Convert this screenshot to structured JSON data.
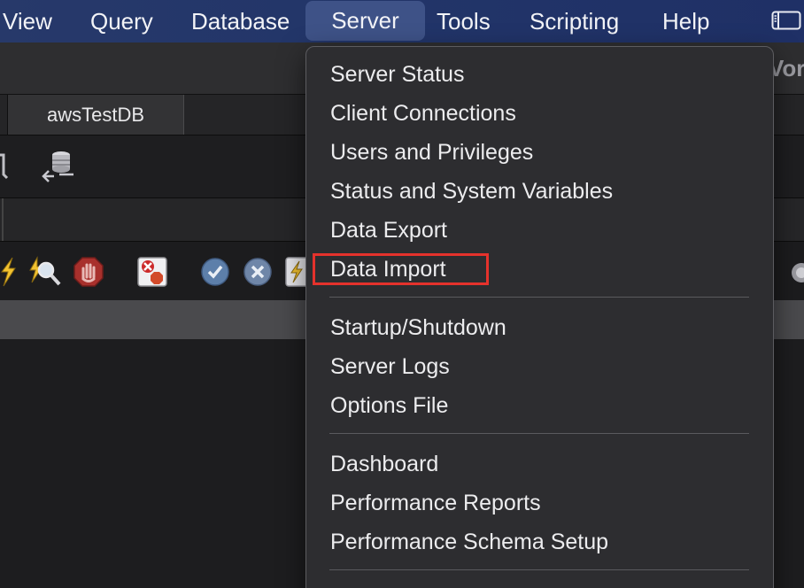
{
  "menubar": {
    "items": [
      "View",
      "Query",
      "Database",
      "Server",
      "Tools",
      "Scripting",
      "Help"
    ],
    "active": "Server",
    "status_icon": "window-sidebar-icon"
  },
  "window": {
    "title_fragment": "Vork",
    "tab_label": "awsTestDB"
  },
  "server_menu": {
    "groups": [
      [
        "Server Status",
        "Client Connections",
        "Users and Privileges",
        "Status and System Variables",
        "Data Export",
        "Data Import"
      ],
      [
        "Startup/Shutdown",
        "Server Logs",
        "Options File"
      ],
      [
        "Dashboard",
        "Performance Reports",
        "Performance Schema Setup"
      ]
    ],
    "highlighted_item": "Data Import",
    "highlight_color": "#e5322c"
  },
  "toolbar_icons": [
    "database-connect-icon",
    "execute-lightning-icon",
    "inspect-magnifier-icon",
    "stop-hand-icon",
    "toggle-error-stop-icon",
    "commit-check-icon",
    "rollback-x-icon",
    "autocommit-icon"
  ],
  "colors": {
    "menubar": "#223569",
    "menu_bg": "#2d2d30",
    "menu_text": "#ececee",
    "active_menu": "#3e5287"
  }
}
